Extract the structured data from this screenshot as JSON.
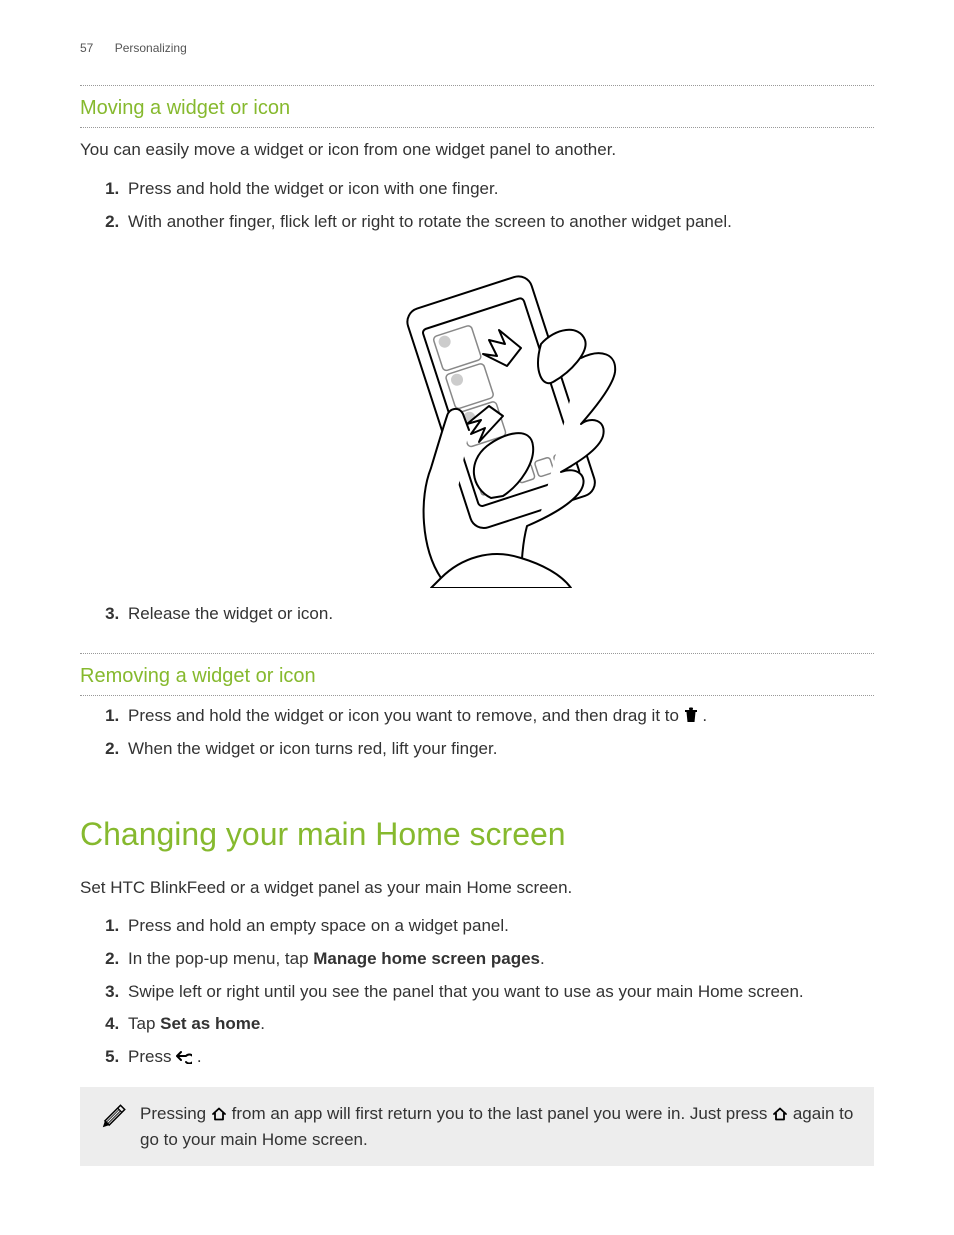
{
  "header": {
    "page_number": "57",
    "section": "Personalizing"
  },
  "sec1": {
    "title": "Moving a widget or icon",
    "intro": "You can easily move a widget or icon from one widget panel to another.",
    "step1": "Press and hold the widget or icon with one finger.",
    "step2": "With another finger, flick left or right to rotate the screen to another widget panel.",
    "step3": "Release the widget or icon."
  },
  "sec2": {
    "title": "Removing a widget or icon",
    "step1_a": "Press and hold the widget or icon you want to remove, and then drag it to ",
    "step1_b": ".",
    "step2": "When the widget or icon turns red, lift your finger."
  },
  "sec3": {
    "title": "Changing your main Home screen",
    "intro": "Set HTC BlinkFeed or a widget panel as your main Home screen.",
    "step1": "Press and hold an empty space on a widget panel.",
    "step2_a": "In the pop-up menu, tap ",
    "step2_bold": "Manage home screen pages",
    "step2_b": ".",
    "step3": "Swipe left or right until you see the panel that you want to use as your main Home screen.",
    "step4_a": "Tap ",
    "step4_bold": "Set as home",
    "step4_b": ".",
    "step5_a": "Press ",
    "step5_b": "."
  },
  "note": {
    "part1": "Pressing ",
    "part2": " from an app will first return you to the last panel you were in. Just press ",
    "part3": " again to go to your main Home screen."
  }
}
